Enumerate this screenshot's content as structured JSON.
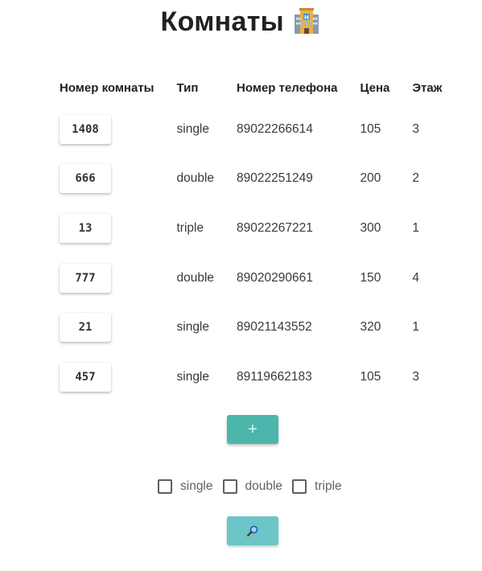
{
  "header": {
    "title": "Комнаты"
  },
  "table": {
    "columns": [
      "Номер комнаты",
      "Тип",
      "Номер телефона",
      "Цена",
      "Этаж"
    ],
    "rows": [
      {
        "number": "1408",
        "type": "single",
        "phone": "89022266614",
        "price": "105",
        "floor": "3"
      },
      {
        "number": "666",
        "type": "double",
        "phone": "89022251249",
        "price": "200",
        "floor": "2"
      },
      {
        "number": "13",
        "type": "triple",
        "phone": "89022267221",
        "price": "300",
        "floor": "1"
      },
      {
        "number": "777",
        "type": "double",
        "phone": "89020290661",
        "price": "150",
        "floor": "4"
      },
      {
        "number": "21",
        "type": "single",
        "phone": "89021143552",
        "price": "320",
        "floor": "1"
      },
      {
        "number": "457",
        "type": "single",
        "phone": "89119662183",
        "price": "105",
        "floor": "3"
      }
    ]
  },
  "actions": {
    "add_label": "+"
  },
  "filters": [
    {
      "label": "single",
      "checked": false
    },
    {
      "label": "double",
      "checked": false
    },
    {
      "label": "triple",
      "checked": false
    }
  ],
  "icons": {
    "title_icon": "hotel-icon",
    "search_icon": "magnifier-icon"
  },
  "colors": {
    "add_button": "#4db6ac",
    "search_button": "#6cc5c7"
  }
}
